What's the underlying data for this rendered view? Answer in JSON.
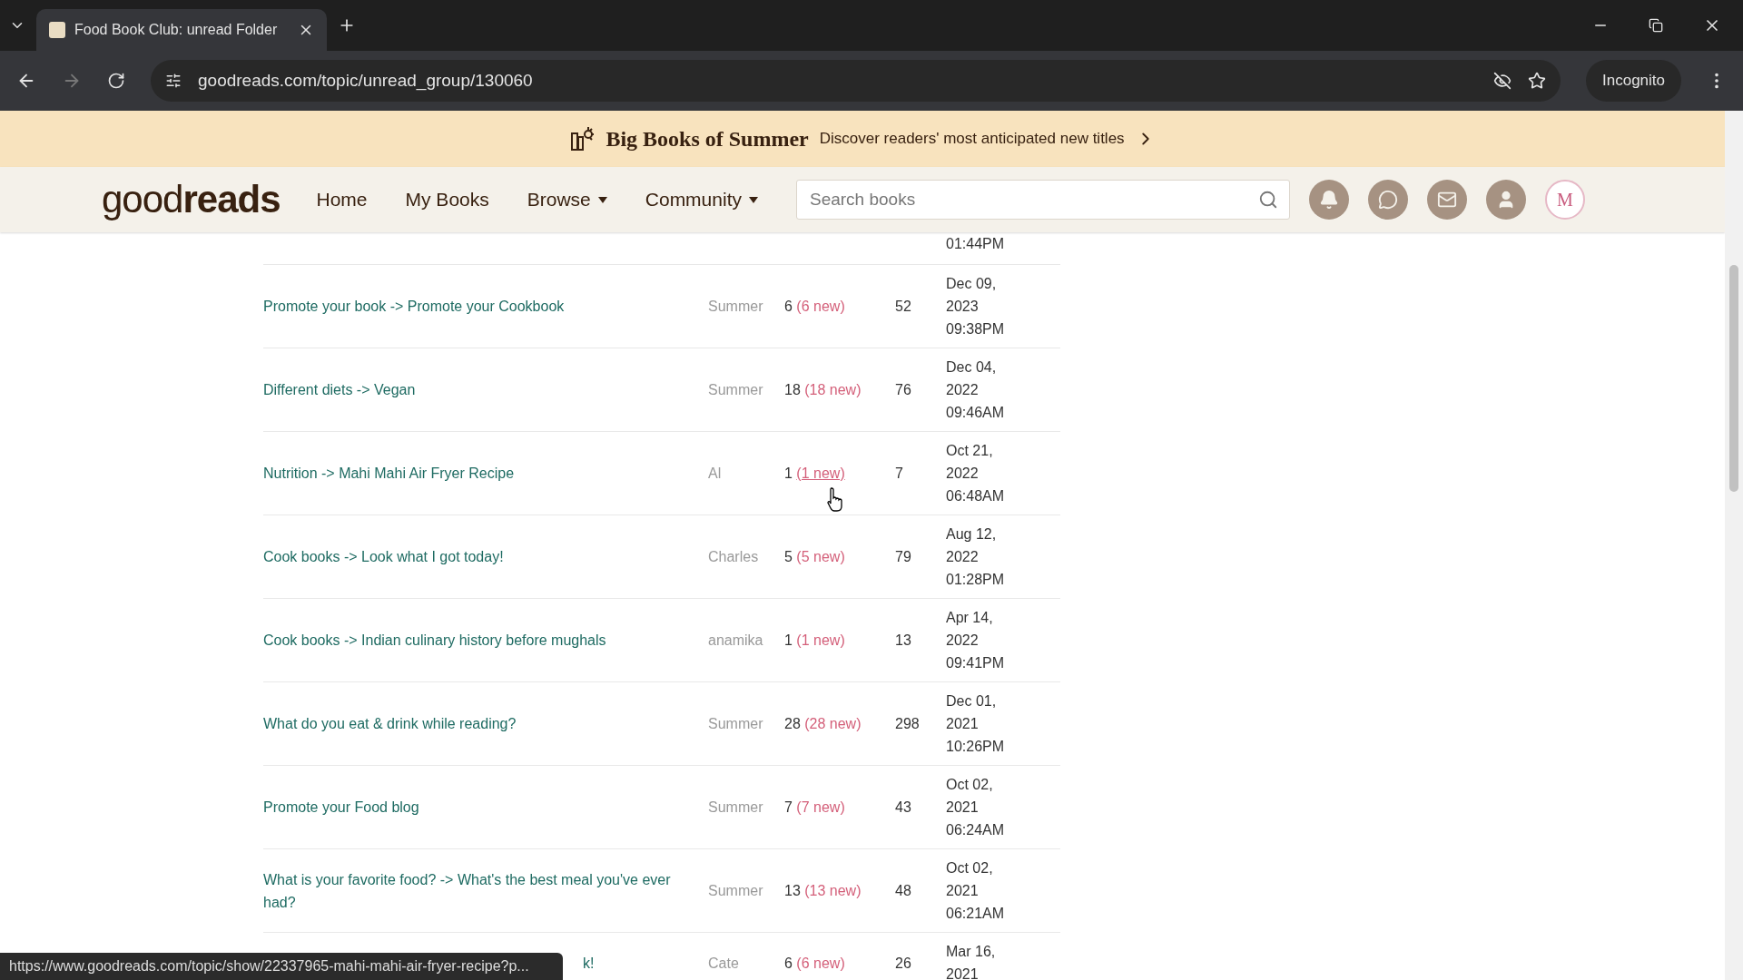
{
  "browser": {
    "tab_title": "Food Book Club: unread Folder",
    "url": "goodreads.com/topic/unread_group/130060",
    "incognito_label": "Incognito"
  },
  "banner": {
    "title": "Big Books of Summer",
    "text": "Discover readers' most anticipated new titles"
  },
  "nav": {
    "logo_light": "good",
    "logo_bold": "reads",
    "items": [
      {
        "label": "Home",
        "dropdown": false
      },
      {
        "label": "My Books",
        "dropdown": false
      },
      {
        "label": "Browse",
        "dropdown": true
      },
      {
        "label": "Community",
        "dropdown": true
      }
    ],
    "search_placeholder": "Search books",
    "avatar_initial": "M"
  },
  "rows": [
    {
      "kind": "partial_top",
      "date": [
        "01:44PM"
      ]
    },
    {
      "kind": "full",
      "topic": [
        {
          "text": "Promote your book -> "
        },
        {
          "text": "Promote your Cookbook"
        }
      ],
      "author": "Summer",
      "count": "6",
      "new": "(6 new)",
      "hovered": false,
      "posts": "52",
      "date": [
        "Dec 09,",
        "2023",
        "09:38PM"
      ]
    },
    {
      "kind": "full",
      "topic": [
        {
          "text": "Different diets -> "
        },
        {
          "text": "Vegan"
        }
      ],
      "author": "Summer",
      "count": "18",
      "new": "(18 new)",
      "hovered": false,
      "posts": "76",
      "date": [
        "Dec 04,",
        "2022",
        "09:46AM"
      ]
    },
    {
      "kind": "full",
      "topic": [
        {
          "text": "Nutrition -> "
        },
        {
          "text": "Mahi Mahi Air Fryer Recipe"
        }
      ],
      "author": "Al",
      "count": "1",
      "new": "(1 new)",
      "hovered": true,
      "posts": "7",
      "date": [
        "Oct 21,",
        "2022",
        "06:48AM"
      ]
    },
    {
      "kind": "full",
      "topic": [
        {
          "text": "Cook books -> "
        },
        {
          "text": "Look what I got today!"
        }
      ],
      "author": "Charles",
      "count": "5",
      "new": "(5 new)",
      "hovered": false,
      "posts": "79",
      "date": [
        "Aug 12,",
        "2022",
        "01:28PM"
      ]
    },
    {
      "kind": "full",
      "topic": [
        {
          "text": "Cook books -> "
        },
        {
          "text": "Indian culinary history before mughals"
        }
      ],
      "author": "anamika",
      "count": "1",
      "new": "(1 new)",
      "hovered": false,
      "posts": "13",
      "date": [
        "Apr 14,",
        "2022",
        "09:41PM"
      ]
    },
    {
      "kind": "full",
      "topic": [
        {
          "text": "What do you eat & drink while reading?"
        }
      ],
      "author": "Summer",
      "count": "28",
      "new": "(28 new)",
      "hovered": false,
      "posts": "298",
      "date": [
        "Dec 01,",
        "2021",
        "10:26PM"
      ]
    },
    {
      "kind": "full",
      "topic": [
        {
          "text": "Promote your Food blog"
        }
      ],
      "author": "Summer",
      "count": "7",
      "new": "(7 new)",
      "hovered": false,
      "posts": "43",
      "date": [
        "Oct 02,",
        "2021",
        "06:24AM"
      ]
    },
    {
      "kind": "full",
      "topic": [
        {
          "text": "What is your favorite food? -> "
        },
        {
          "text": "What's the best meal you've ever had?"
        }
      ],
      "author": "Summer",
      "count": "13",
      "new": "(13 new)",
      "hovered": false,
      "posts": "48",
      "date": [
        "Oct 02,",
        "2021",
        "06:21AM"
      ]
    },
    {
      "kind": "covered",
      "topic": [
        {
          "text": "k!"
        }
      ],
      "author": "Cate",
      "count": "6",
      "new": "(6 new)",
      "hovered": false,
      "posts": "26",
      "date": [
        "Mar 16,",
        "2021"
      ]
    }
  ],
  "status_url": "https://www.goodreads.com/topic/show/22337965-mahi-mahi-air-fryer-recipe?p..."
}
